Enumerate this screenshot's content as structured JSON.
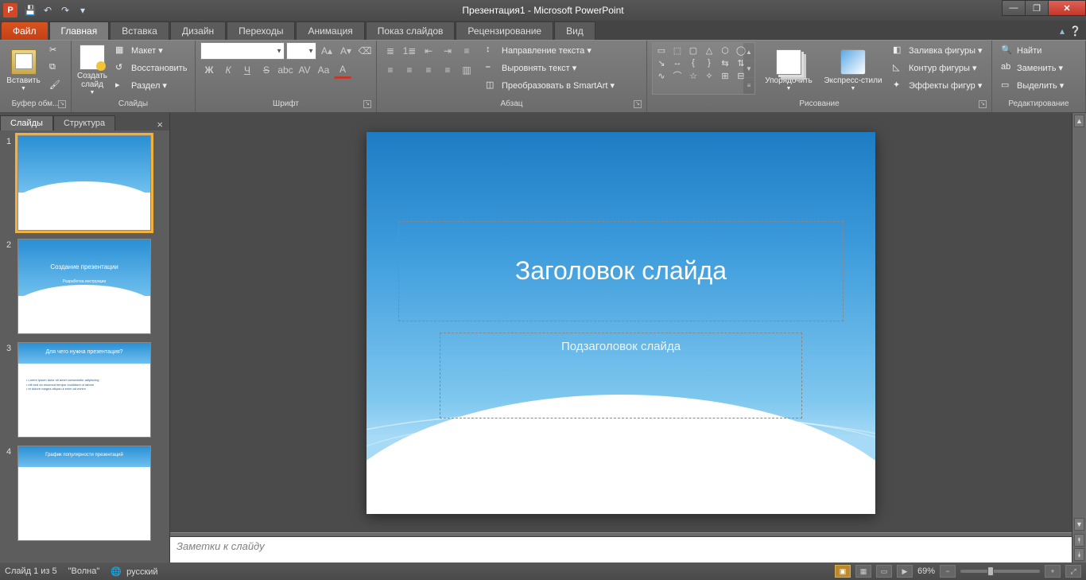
{
  "titlebar": {
    "app_logo": "P",
    "title": "Презентация1 - Microsoft PowerPoint"
  },
  "qat": {
    "save": "💾",
    "undo": "↶",
    "redo": "↷",
    "more": "▾"
  },
  "win": {
    "min": "—",
    "max": "❐",
    "close": "✕"
  },
  "tabs": {
    "file": "Файл",
    "items": [
      "Главная",
      "Вставка",
      "Дизайн",
      "Переходы",
      "Анимация",
      "Показ слайдов",
      "Рецензирование",
      "Вид"
    ],
    "active": 0
  },
  "ribbon": {
    "clipboard": {
      "label": "Буфер обм...",
      "paste": "Вставить",
      "cut_ic": "✂",
      "copy_ic": "⧉",
      "fmt_ic": "🖌"
    },
    "slides": {
      "label": "Слайды",
      "new": "Создать\nслайд",
      "layout": "Макет ▾",
      "reset": "Восстановить",
      "section": "Раздел ▾",
      "layout_ic": "▦",
      "reset_ic": "↺",
      "section_ic": "▸"
    },
    "font": {
      "label": "Шрифт",
      "name": "",
      "size": "",
      "grow": "A▴",
      "shrink": "A▾",
      "clear": "⌫",
      "bold": "Ж",
      "italic": "К",
      "under": "Ч",
      "strike": "S",
      "shadow": "abc",
      "spacing": "AV",
      "case": "Aa",
      "color": "A"
    },
    "para": {
      "label": "Абзац",
      "bul": "≣",
      "num": "1≣",
      "lvl": "⇥",
      "lh": "≡",
      "dir": "Направление текста ▾",
      "align": "Выровнять текст ▾",
      "smart": "Преобразовать в SmartArt ▾",
      "al": "≡",
      "ac": "≡",
      "ar": "≡",
      "aj": "≡",
      "col": "▥",
      "indL": "⇤",
      "indR": "⇥"
    },
    "draw": {
      "label": "Рисование",
      "arrange": "Упорядочить",
      "qstyles": "Экспресс-стили",
      "fill": "Заливка фигуры ▾",
      "outline": "Контур фигуры ▾",
      "effects": "Эффекты фигур ▾",
      "fill_ic": "◧",
      "outline_ic": "◺",
      "effects_ic": "✦",
      "shapes": [
        "▭",
        "⬚",
        "▢",
        "△",
        "⬡",
        "◯",
        "↘",
        "↔",
        "{",
        "}",
        "⇆",
        "⇅",
        "∿",
        "⌒",
        "☆",
        "✧",
        "⊞",
        "⊟"
      ]
    },
    "edit": {
      "label": "Редактирование",
      "find": "Найти",
      "replace": "Заменить ▾",
      "select": "Выделить ▾",
      "find_ic": "🔍",
      "replace_ic": "ab",
      "select_ic": "▭"
    }
  },
  "panel": {
    "tab_slides": "Слайды",
    "tab_outline": "Структура",
    "close": "×",
    "thumbs": [
      {
        "n": "1",
        "title": "",
        "sub": ""
      },
      {
        "n": "2",
        "title": "Создание презентации",
        "sub": "Разработка  инструкции"
      },
      {
        "n": "3",
        "title": "Для чего нужна презентация?",
        "sub": ""
      },
      {
        "n": "4",
        "title": "График популярности презентаций",
        "sub": ""
      }
    ]
  },
  "slide": {
    "title": "Заголовок слайда",
    "sub": "Подзаголовок слайда"
  },
  "notes": {
    "placeholder": "Заметки к слайду"
  },
  "status": {
    "pos": "Слайд 1 из 5",
    "theme": "\"Волна\"",
    "lang": "русский",
    "lang_ic": "🌐",
    "zoom": "69%",
    "fit": "⤢",
    "minus": "−",
    "plus": "+"
  }
}
